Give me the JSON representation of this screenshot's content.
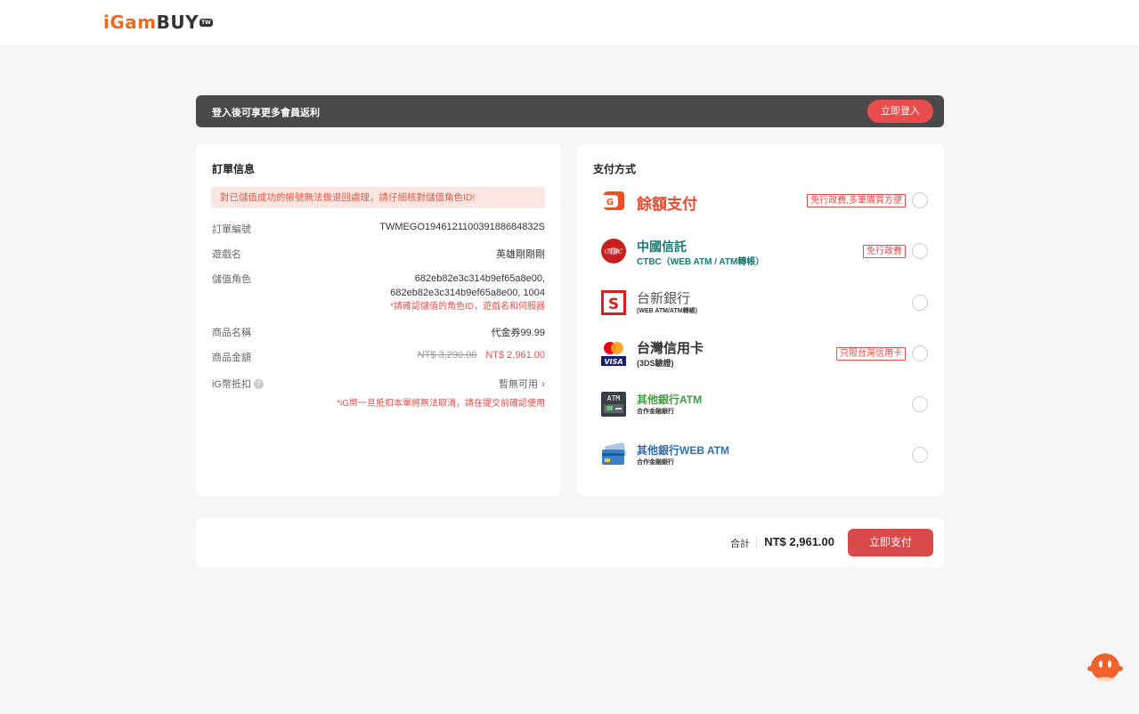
{
  "header": {
    "logo_i": "i",
    "logo_gam": "Gam",
    "logo_buy": "BUY",
    "logo_region": "TW"
  },
  "login_bar": {
    "text": "登入後可享更多會員返利",
    "button": "立即登入"
  },
  "order": {
    "title": "訂單信息",
    "warning": "對已儲值成功的帳號無法做退回處理，請仔細核對儲值角色ID!",
    "rows": {
      "order_no_label": "訂單編號",
      "order_no": "TWMEGO194612110039188684832S",
      "game_label": "遊戲名",
      "game": "英雄剛剛剛",
      "role_label": "儲值角色",
      "role_line1": "682eb82e3c314b9ef65a8e00,",
      "role_line2": "682eb82e3c314b9ef65a8e00, 1004",
      "role_note": "*請確認儲值的角色ID，遊戲名和伺服器",
      "product_label": "商品名稱",
      "product": "代金券99.99",
      "amount_label": "商品金額",
      "amount_original": "NT$ 3,290.00",
      "amount_final": "NT$ 2,961.00",
      "ig_label": "iG幣抵扣",
      "ig_help": "?",
      "ig_value": "暫無可用",
      "ig_note": "*iG幣一旦抵扣本單將無法取消，請在提交前確認使用"
    }
  },
  "payment": {
    "title": "支付方式",
    "methods": [
      {
        "name": "餘額支付",
        "sub": "",
        "tag": "免行政費,多筆購買方便",
        "color": "#e84c2c"
      },
      {
        "name": "中國信託",
        "sub": "CTBC（WEB ATM / ATM轉帳）",
        "tag": "免行政費",
        "color": "#1a7a72"
      },
      {
        "name": "台新銀行",
        "sub": "(WEB ATM/ATM轉帳)",
        "tag": "",
        "color": "#666666"
      },
      {
        "name": "台灣信用卡",
        "sub": "(3DS驗證)",
        "tag": "只限台灣信用卡",
        "color": "#333333"
      },
      {
        "name": "其他銀行ATM",
        "sub": "合作金融銀行",
        "tag": "",
        "color": "#3ca03c"
      },
      {
        "name": "其他銀行WEB ATM",
        "sub": "合作金融銀行",
        "tag": "",
        "color": "#2a6db5"
      }
    ]
  },
  "total": {
    "label": "合計",
    "value": "NT$ 2,961.00",
    "button": "立即支付"
  },
  "icons": [
    "logo",
    "g-wallet-icon",
    "ctbc-icon",
    "taishin-icon",
    "mastercard-visa-icon",
    "atm-icon",
    "web-atm-card-icon",
    "chevron-right-icon",
    "help-icon",
    "mascot-icon"
  ]
}
